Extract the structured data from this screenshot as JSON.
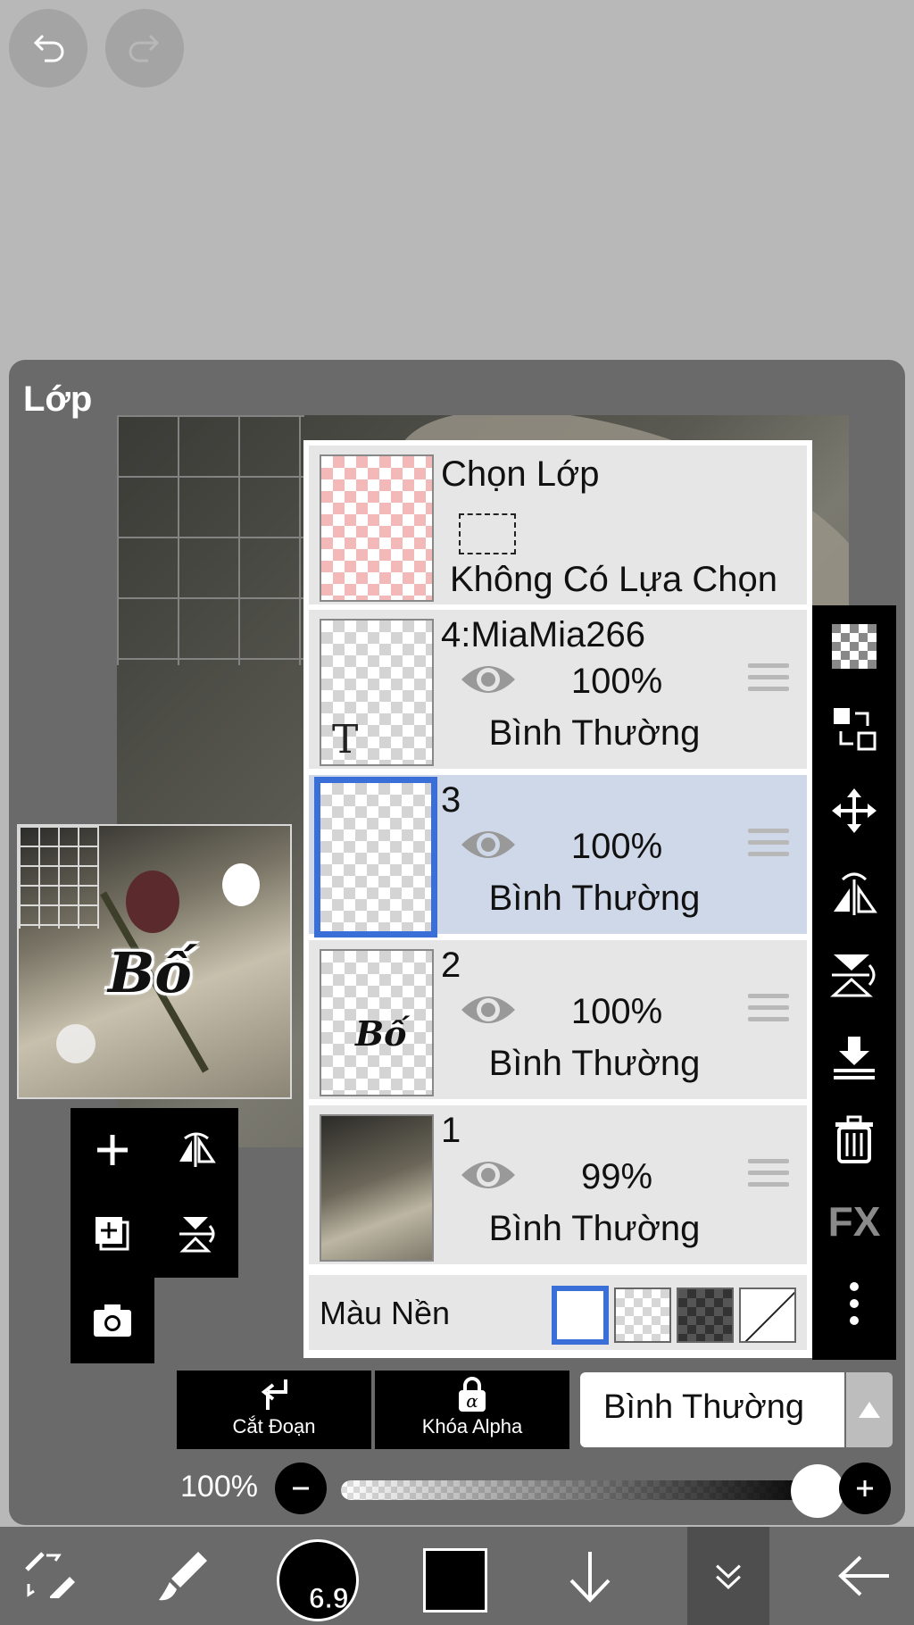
{
  "top": {
    "undo_icon": "undo-icon",
    "redo_icon": "redo-icon"
  },
  "panel": {
    "title": "Lớp"
  },
  "preview": {
    "word": "Bố"
  },
  "selection_layer": {
    "title": "Chọn Lớp",
    "status": "Không Có Lựa Chọn"
  },
  "layers": [
    {
      "name": "4:MiaMia266",
      "opacity": "100%",
      "blend": "Bình Thường",
      "thumb_glyph": "T"
    },
    {
      "name": "3",
      "opacity": "100%",
      "blend": "Bình Thường",
      "selected": true
    },
    {
      "name": "2",
      "opacity": "100%",
      "blend": "Bình Thường",
      "thumb_text": "Bố"
    },
    {
      "name": "1",
      "opacity": "99%",
      "blend": "Bình Thường"
    }
  ],
  "background": {
    "label": "Màu Nền",
    "options": [
      "white",
      "checker-light",
      "checker-dark",
      "none"
    ],
    "selected": "white"
  },
  "right_tools": {
    "fx_label": "FX"
  },
  "actions": {
    "clip_label": "Cắt Đoạn",
    "alpha_label": "Khóa Alpha",
    "blend_mode": "Bình Thường"
  },
  "opacity_control": {
    "value": "100%",
    "fraction": 1.0
  },
  "toolbar": {
    "brush_size": "6.9",
    "color": "#000000"
  },
  "colors": {
    "accent": "#3a6fd8",
    "panel": "#6a6a6a",
    "selected_row": "#cfd8e8"
  }
}
